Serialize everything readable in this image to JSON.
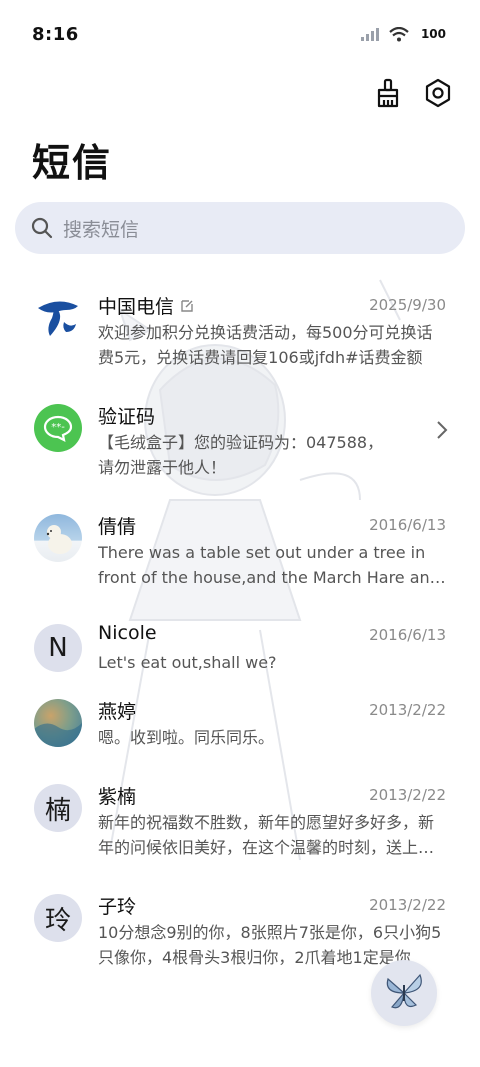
{
  "status": {
    "time": "8:16",
    "battery": "100"
  },
  "header": {
    "title": "短信"
  },
  "search": {
    "placeholder": "搜索短信"
  },
  "conversations": [
    {
      "name": "中国电信",
      "date": "2025/9/30",
      "preview": "欢迎参加积分兑换话费活动，每500分可兑换话费5元，兑换话费请回复106或jfdh#话费金额"
    },
    {
      "name": "验证码",
      "date": "",
      "preview": "【毛绒盒子】您的验证码为：047588，请勿泄露于他人！"
    },
    {
      "name": "倩倩",
      "date": "2016/6/13",
      "preview": "There was a table set out under a tree in front of the house,and the March Hare and the Hatter"
    },
    {
      "name": "Nicole",
      "date": "2016/6/13",
      "preview": "Let's eat out,shall we?",
      "avatar_letter": "N"
    },
    {
      "name": "燕婷",
      "date": "2013/2/22",
      "preview": "嗯。收到啦。同乐同乐。"
    },
    {
      "name": "紫楠",
      "date": "2013/2/22",
      "preview": "新年的祝福数不胜数，新年的愿望好多好多，新年的问候依旧美好，在这个温馨的时刻，送上祝福",
      "avatar_letter": "楠"
    },
    {
      "name": "子玲",
      "date": "2013/2/22",
      "preview": "10分想念9别的你，8张照片7张是你，6只小狗5只像你，4根骨头3根归你，2爪着地1定是你",
      "avatar_letter": "玲"
    }
  ],
  "colors": {
    "accent": "#1a4fa0",
    "green": "#4cc451",
    "search_bg": "#e8ebf5"
  }
}
